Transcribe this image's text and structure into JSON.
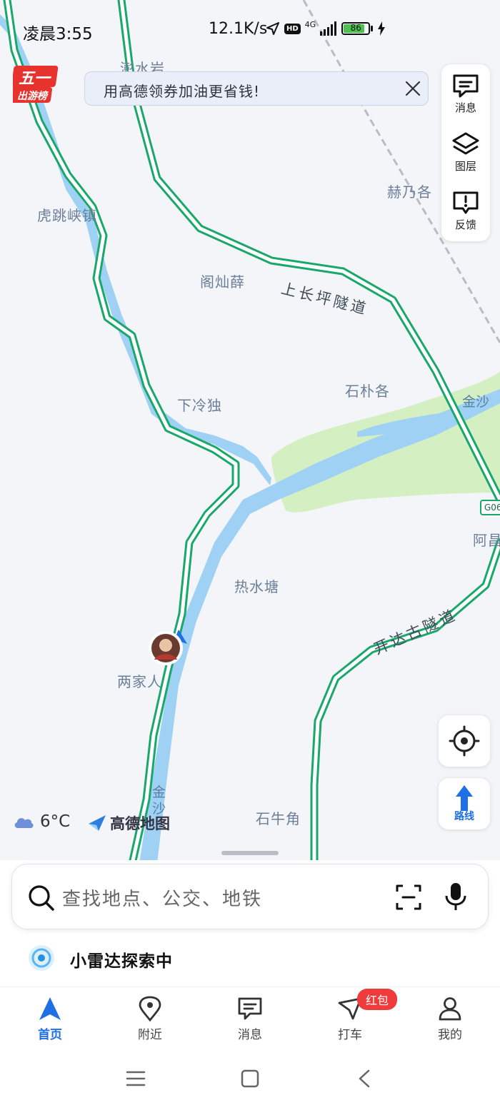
{
  "status_bar": {
    "time": "凌晨3:55",
    "speed": "12.1K/s",
    "hd": "HD",
    "network": "4G",
    "battery": "86",
    "battery_level": 0.86
  },
  "promo_badge": {
    "line1": "五一",
    "line2": "出游榜"
  },
  "banner": {
    "text": "用高德领券加油更省钱!"
  },
  "side_panel": {
    "messages": "消息",
    "layers": "图层",
    "feedback": "反馈"
  },
  "map": {
    "places": {
      "penshuiyan": "澎水岩",
      "hutiaoxia": "虎跳峡镇",
      "henaige": "赫乃各",
      "gecanxue": "阁灿薛",
      "xialengdu": "下冷独",
      "shipuge": "石朴各",
      "reshuitang": "热水塘",
      "liangjiaren": "两家人",
      "shiniujiao": "石牛角",
      "achang": "阿昌"
    },
    "roads": {
      "shangchangping": "上长坪隧道",
      "kaidagu": "开达古隧道",
      "highway_shield": "G06"
    },
    "rivers": {
      "jinsha_east": "金沙",
      "jinsha_south_1": "金",
      "jinsha_south_2": "沙"
    }
  },
  "weather": {
    "temp": "6°C",
    "icon": "cloud-icon"
  },
  "brand": {
    "name": "高德地图"
  },
  "search": {
    "placeholder": "查找地点、公交、地铁"
  },
  "radar": {
    "text": "小雷达探索中"
  },
  "tabs": [
    {
      "label": "首页",
      "icon": "navigation-arrow-icon",
      "active": true
    },
    {
      "label": "附近",
      "icon": "location-pin-icon"
    },
    {
      "label": "消息",
      "icon": "message-icon"
    },
    {
      "label": "打车",
      "icon": "taxi-icon",
      "badge": "红包"
    },
    {
      "label": "我的",
      "icon": "user-icon"
    }
  ],
  "float_buttons": {
    "route": "路线"
  },
  "colors": {
    "accent": "#1f6fe5",
    "road_green": "#1aa86a",
    "river": "#9fd1f5",
    "park": "#d4efc2",
    "badge_red": "#ef3b3b"
  }
}
